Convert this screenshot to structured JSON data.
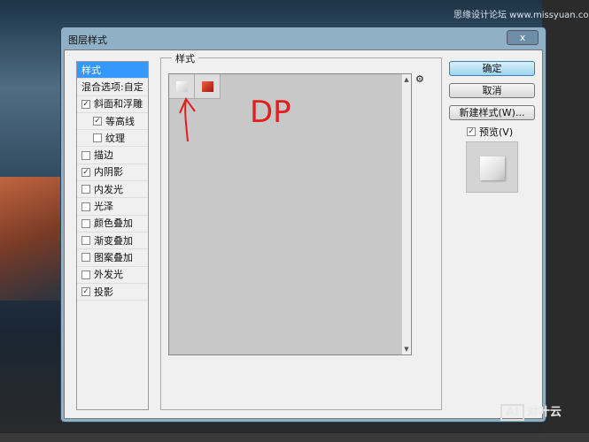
{
  "watermark_top": "思缘设计论坛 www.missyuan.com",
  "watermark_bottom": {
    "logo": "AI",
    "text": "对叶云"
  },
  "dialog": {
    "title": "图层样式",
    "close": "x"
  },
  "list": [
    {
      "label": "样式",
      "selected": true
    },
    {
      "label": "混合选项:自定"
    },
    {
      "label": "斜面和浮雕",
      "checked": true
    },
    {
      "label": "等高线",
      "checked": true,
      "indent": true
    },
    {
      "label": "纹理",
      "checked": false,
      "indent": true
    },
    {
      "label": "描边",
      "checked": false
    },
    {
      "label": "内阴影",
      "checked": true
    },
    {
      "label": "内发光",
      "checked": false
    },
    {
      "label": "光泽",
      "checked": false
    },
    {
      "label": "颜色叠加",
      "checked": false
    },
    {
      "label": "渐变叠加",
      "checked": false
    },
    {
      "label": "图案叠加",
      "checked": false
    },
    {
      "label": "外发光",
      "checked": false
    },
    {
      "label": "投影",
      "checked": true
    }
  ],
  "styles_group": {
    "label": "样式",
    "gear": "⚙"
  },
  "annotation": "DP",
  "buttons": {
    "ok": "确定",
    "cancel": "取消",
    "new_style": "新建样式(W)...",
    "preview": "预览(V)",
    "preview_checked": true
  }
}
